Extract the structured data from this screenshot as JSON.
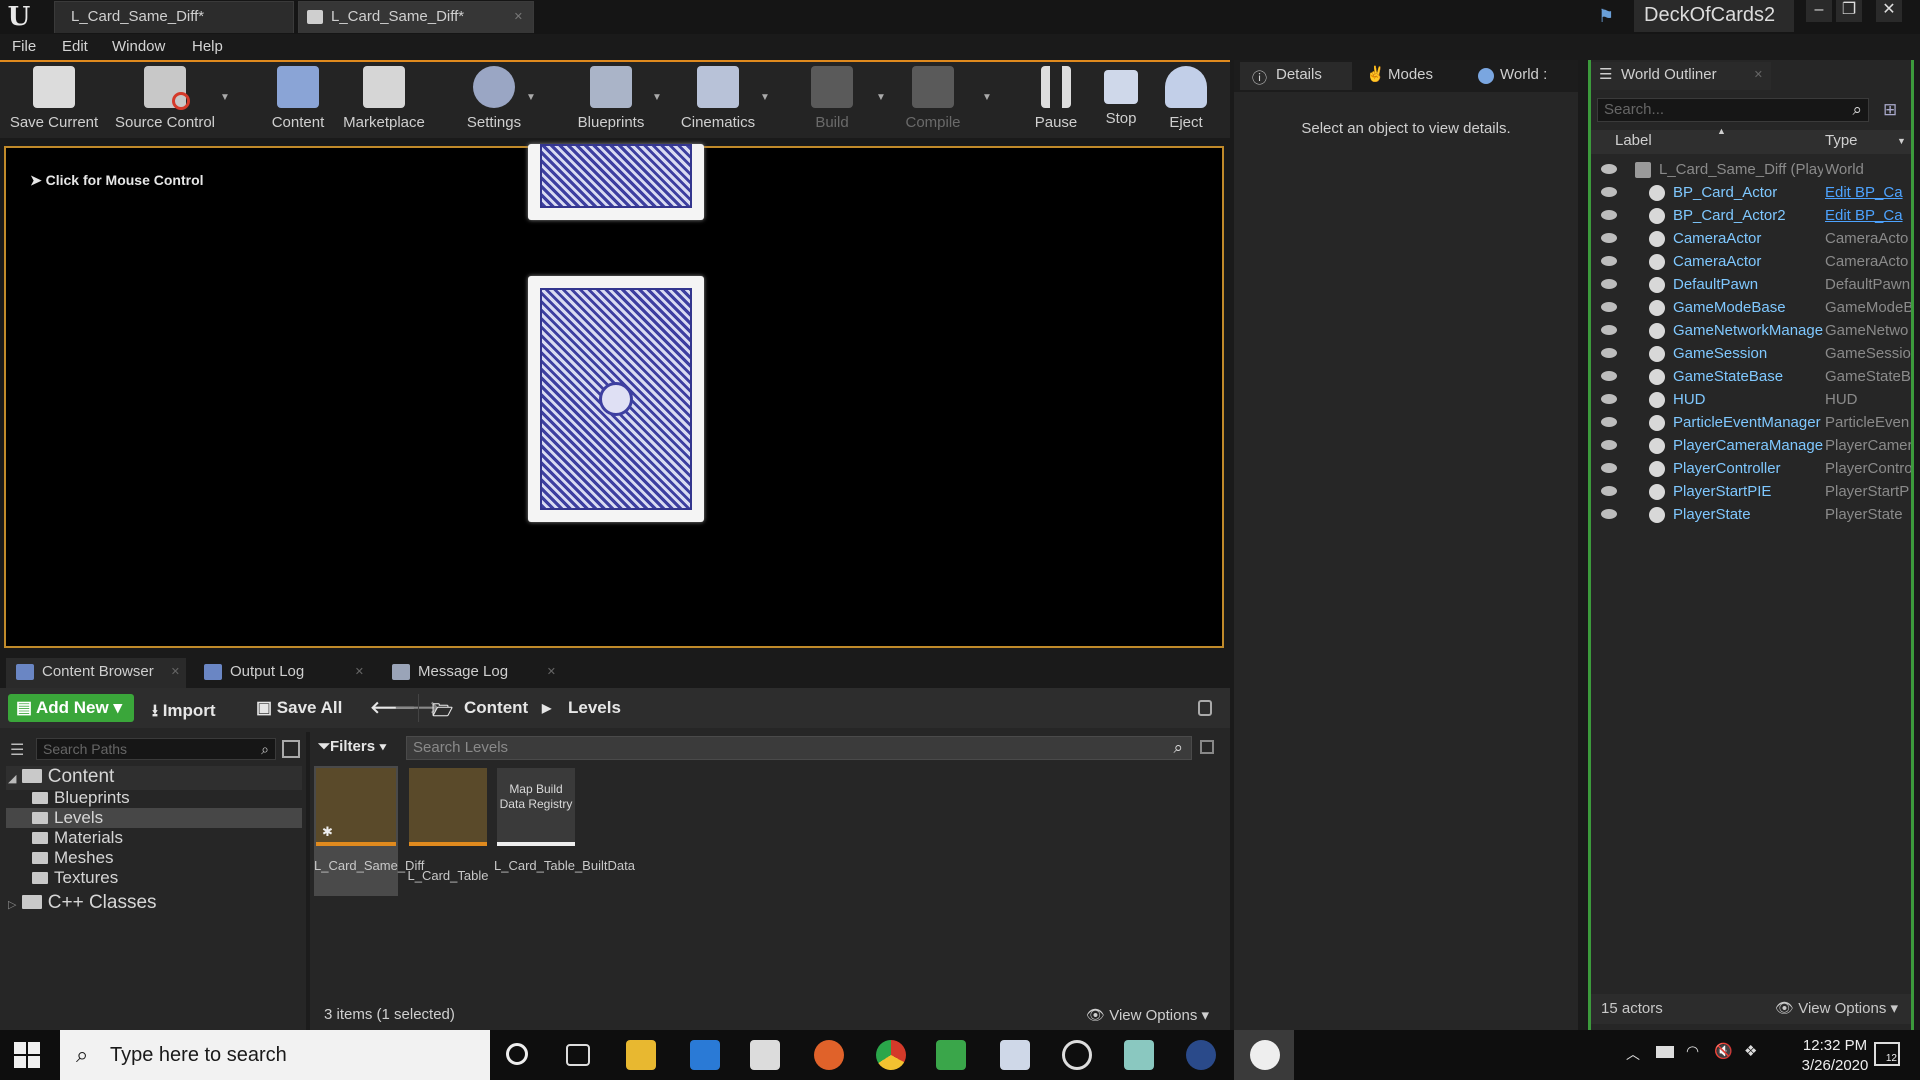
{
  "title_bar": {
    "tabs": [
      "L_Card_Same_Diff*",
      "L_Card_Same_Diff*"
    ],
    "project_name": "DeckOfCards2"
  },
  "menu": [
    "File",
    "Edit",
    "Window",
    "Help"
  ],
  "toolbar": {
    "buttons": [
      "Save Current",
      "Source Control",
      "Content",
      "Marketplace",
      "Settings",
      "Blueprints",
      "Cinematics",
      "Build",
      "Compile",
      "Pause",
      "Stop",
      "Eject"
    ]
  },
  "viewport": {
    "mouse_hint": "Click for Mouse Control"
  },
  "bottom_tabs": [
    "Content Browser",
    "Output Log",
    "Message Log"
  ],
  "content_browser": {
    "add_new": "Add New",
    "import": "Import",
    "save_all": "Save All",
    "breadcrumb": [
      "Content",
      "Levels"
    ],
    "search_paths_placeholder": "Search Paths",
    "filters": "Filters",
    "search_levels_placeholder": "Search Levels",
    "tree": {
      "root": "Content",
      "children": [
        "Blueprints",
        "Levels",
        "Materials",
        "Meshes",
        "Textures"
      ],
      "cpp": "C++ Classes"
    },
    "assets": [
      {
        "name": "L_Card_Same_Diff",
        "selected": true
      },
      {
        "name": "L_Card_Table",
        "selected": false
      },
      {
        "name": "L_Card_Table_BuiltData",
        "thumb_text": "Map Build Data Registry",
        "selected": false
      }
    ],
    "items_status": "3 items (1 selected)",
    "view_options": "View Options"
  },
  "details": {
    "tabs": [
      "Details",
      "Modes",
      "World :"
    ],
    "empty_message": "Select an object to view details."
  },
  "world_outliner": {
    "title": "World Outliner",
    "search_placeholder": "Search...",
    "col_label": "Label",
    "col_type": "Type",
    "rows": [
      {
        "label": "L_Card_Same_Diff (Play",
        "type": "World"
      },
      {
        "label": "BP_Card_Actor",
        "type": "Edit BP_Ca"
      },
      {
        "label": "BP_Card_Actor2",
        "type": "Edit BP_Ca"
      },
      {
        "label": "CameraActor",
        "type": "CameraActo"
      },
      {
        "label": "CameraActor",
        "type": "CameraActo"
      },
      {
        "label": "DefaultPawn",
        "type": "DefaultPawn"
      },
      {
        "label": "GameModeBase",
        "type": "GameModeB"
      },
      {
        "label": "GameNetworkManage",
        "type": "GameNetwo"
      },
      {
        "label": "GameSession",
        "type": "GameSessio"
      },
      {
        "label": "GameStateBase",
        "type": "GameStateB"
      },
      {
        "label": "HUD",
        "type": "HUD"
      },
      {
        "label": "ParticleEventManager",
        "type": "ParticleEven"
      },
      {
        "label": "PlayerCameraManage",
        "type": "PlayerCamer"
      },
      {
        "label": "PlayerController",
        "type": "PlayerContro"
      },
      {
        "label": "PlayerStartPIE",
        "type": "PlayerStartP"
      },
      {
        "label": "PlayerState",
        "type": "PlayerState"
      }
    ],
    "actor_count": "15 actors",
    "view_options": "View Options"
  },
  "taskbar": {
    "search_placeholder": "Type here to search",
    "time": "12:32 PM",
    "date": "3/26/2020",
    "notification_count": "12"
  }
}
